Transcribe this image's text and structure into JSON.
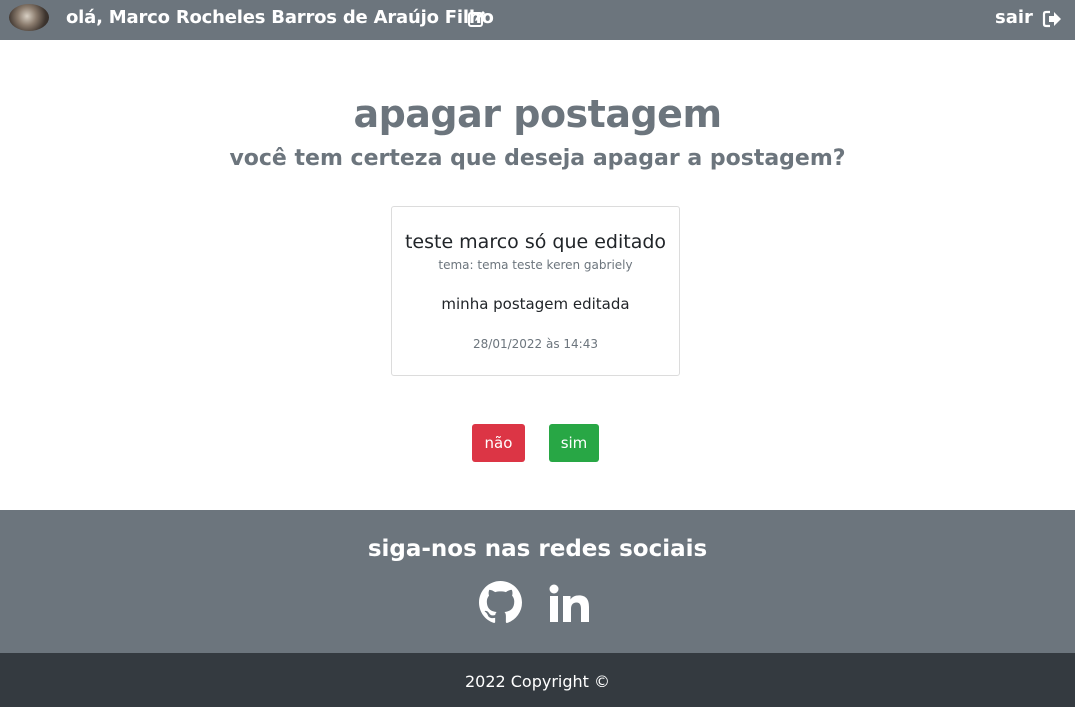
{
  "header": {
    "greeting": "olá, Marco Rocheles Barros de Araújo Filho",
    "logout_label": "sair",
    "icons": {
      "edit": "edit-icon",
      "logout": "logout-icon"
    }
  },
  "main": {
    "title": "apagar postagem",
    "subtitle": "você tem certeza que deseja apagar a postagem?",
    "post": {
      "title": "teste marco só que editado",
      "theme": "tema: tema teste keren gabriely",
      "text": "minha postagem editada",
      "date": "28/01/2022 às 14:43"
    },
    "buttons": {
      "no_label": "não",
      "yes_label": "sim"
    }
  },
  "footer": {
    "social_title": "siga-nos nas redes sociais",
    "social_icons": [
      "github-icon",
      "linkedin-icon"
    ],
    "copyright": "2022 Copyright ©"
  },
  "colors": {
    "header_bg": "#6c757d",
    "danger": "#dc3545",
    "success": "#28a745",
    "footer_dark": "#343a40"
  }
}
